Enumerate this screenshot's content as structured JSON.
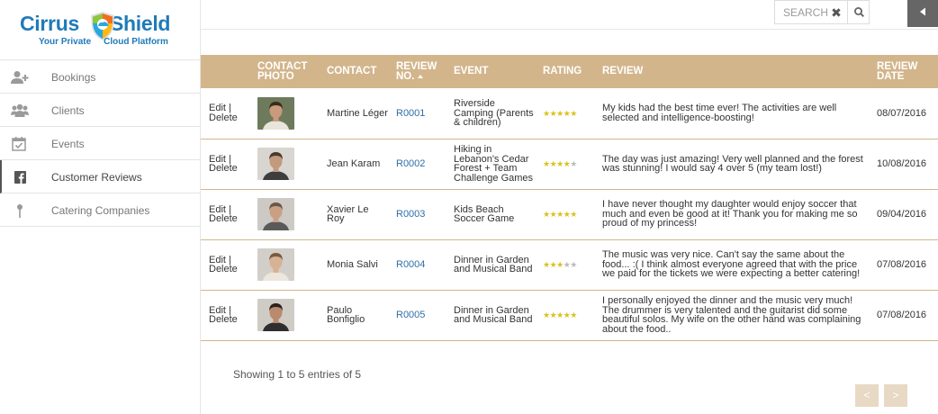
{
  "brand": {
    "name_part1": "Cirrus",
    "name_part2": "Shield",
    "tagline_part1": "Your Private",
    "tagline_part2": "Cloud Platform",
    "color": "#1f7bb9"
  },
  "sidebar": {
    "items": [
      {
        "label": "Bookings",
        "icon": "add-user-icon",
        "active": false
      },
      {
        "label": "Clients",
        "icon": "users-icon",
        "active": false
      },
      {
        "label": "Events",
        "icon": "calendar-check-icon",
        "active": false
      },
      {
        "label": "Customer Reviews",
        "icon": "facebook-icon",
        "active": true
      },
      {
        "label": "Catering Companies",
        "icon": "pin-icon",
        "active": false
      }
    ]
  },
  "search": {
    "placeholder": "SEARCH",
    "clear_icon": "close-icon",
    "button_icon": "search-icon"
  },
  "header": {
    "collapse_icon": "caret-left-icon"
  },
  "table": {
    "header_color": "#d3b58c",
    "columns": {
      "photo": "CONTACT PHOTO",
      "contact": "CONTACT",
      "review_no": "REVIEW NO.",
      "event": "EVENT",
      "rating": "RATING",
      "review": "REVIEW",
      "date": "REVIEW DATE"
    },
    "sort_column": "review_no",
    "sort_direction": "asc",
    "actions": {
      "edit": "Edit",
      "separator": "|",
      "delete": "Delete"
    },
    "rows": [
      {
        "contact": "Martine Léger",
        "ref": "R0001",
        "event": "Riverside Camping (Parents & children)",
        "rating": 5,
        "review": "My kids had the best time ever! The activities are well selected and intelligence-boosting!",
        "date": "08/07/2016"
      },
      {
        "contact": "Jean Karam",
        "ref": "R0002",
        "event": "Hiking in Lebanon's Cedar Forest + Team Challenge Games",
        "rating": 4,
        "review": "The day was just amazing! Very well planned and the forest was stunning! I would say 4 over 5 (my team lost!)",
        "date": "10/08/2016"
      },
      {
        "contact": "Xavier Le Roy",
        "ref": "R0003",
        "event": "Kids Beach Soccer Game",
        "rating": 5,
        "review": "I have never thought my daughter would enjoy soccer that much and even be good at it! Thank you for making me so proud of my princess!",
        "date": "09/04/2016"
      },
      {
        "contact": "Monia Salvi",
        "ref": "R0004",
        "event": "Dinner in Garden and Musical Band",
        "rating": 3,
        "review": "The music was very nice. Can't say the same about the food... :( I think almost everyone agreed that with the price we paid for the tickets we were expecting a better catering!",
        "date": "07/08/2016"
      },
      {
        "contact": "Paulo Bonfiglio",
        "ref": "R0005",
        "event": "Dinner in Garden and Musical Band",
        "rating": 5,
        "review": "I personally enjoyed the dinner and the music very much! The drummer is very talented and the guitarist did some beautiful solos. My wife on the other hand was complaining about the food..",
        "date": "07/08/2016"
      }
    ]
  },
  "pagination": {
    "info": "Showing 1 to 5 entries of 5",
    "prev_label": "<",
    "next_label": ">"
  }
}
